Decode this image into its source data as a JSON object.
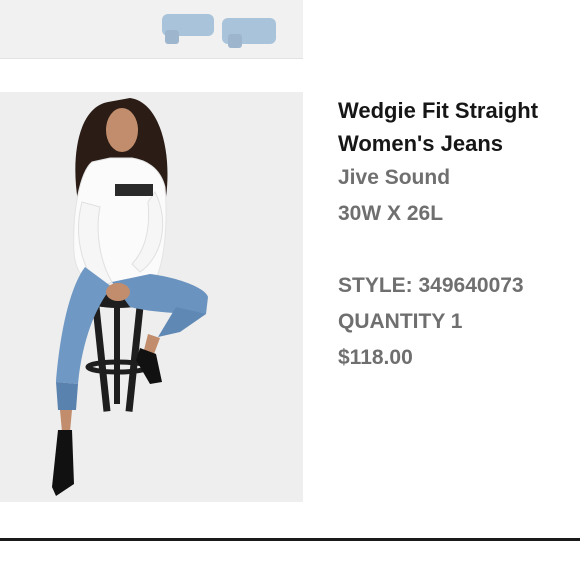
{
  "previous_item": {
    "image": "sandals-photo"
  },
  "product": {
    "image": "model-seated-on-stool-photo",
    "title_line1": "Wedgie Fit Straight",
    "title_line2": "Women's Jeans",
    "color": "Jive Sound",
    "size": "30W X 26L",
    "style": "STYLE: 349640073",
    "quantity": "QUANTITY 1",
    "price": "$118.00"
  },
  "colors": {
    "title_text": "#161616",
    "meta_text": "#6f6f6f",
    "photo_background": "#eeeeee",
    "denim": "#6b93bf",
    "divider": "#1a1a1a"
  }
}
